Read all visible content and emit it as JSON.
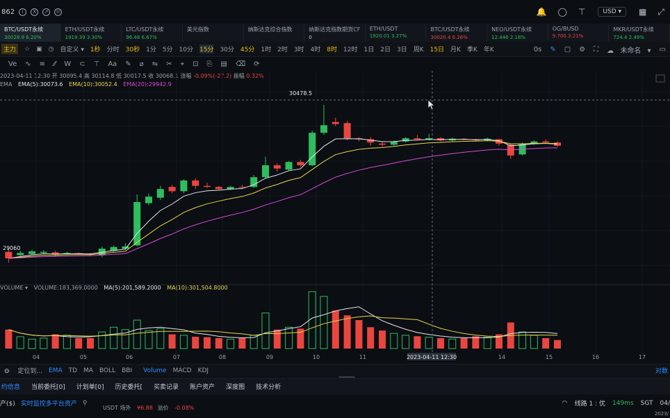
{
  "header": {
    "price_id": "862",
    "right_select": "USD",
    "icons": [
      "bell-icon",
      "search-icon",
      "shirt-icon",
      "grid-icon",
      "expand-icon"
    ]
  },
  "tickers": [
    {
      "name": "BTC/USDT永续",
      "value": "30028.9  6.20%",
      "dir": "up",
      "active": true
    },
    {
      "name": "ETH/USDT永续",
      "value": "1919.39  3.30%",
      "dir": "up"
    },
    {
      "name": "LTC/USDT永续",
      "value": "96.48  6.67%",
      "dir": "up"
    },
    {
      "name": "美元指数",
      "value": "",
      "dir": "none"
    },
    {
      "name": "纳斯达克综合指数",
      "value": "",
      "dir": "none"
    },
    {
      "name": "纳斯达克指数期货CF",
      "value": "0",
      "dir": "none"
    },
    {
      "name": "ETH/USDT",
      "value": "1920.01  3.27%",
      "dir": "up"
    },
    {
      "name": "BTC/USDT永续",
      "value": "30020.4  6.26%",
      "dir": "down"
    },
    {
      "name": "NEO/USDT永续",
      "value": "12.446  2.18%",
      "dir": "up"
    },
    {
      "name": "OG/BUSD",
      "value": "9.700  3.21%",
      "dir": "down"
    },
    {
      "name": "MKR/USDT永续",
      "value": "724.4  2.49%",
      "dir": "up"
    }
  ],
  "intervals": {
    "lead": "主力",
    "custom": "自定义",
    "items": [
      "1秒",
      "分时",
      "30秒",
      "1分",
      "5分",
      "10分",
      "15分",
      "30分",
      "45分",
      "1时",
      "2时",
      "3时",
      "4时",
      "8时",
      "12时",
      "1日",
      "2日",
      "3日",
      "周K",
      "15日",
      "月K",
      "季K",
      "年K"
    ],
    "active": "15分",
    "right_label": "0s",
    "layout_name": "未命名"
  },
  "tools": [
    "Ve",
    "∿",
    "≡",
    "⁄⁄",
    "W",
    "⊂",
    "⊤",
    "Aa",
    "✎",
    "⌀",
    "⇋",
    "✂",
    "⌖",
    "⊡",
    "⎘",
    "▤",
    "⌫",
    "⟳"
  ],
  "ohlc": {
    "date": "2023-04-11 12:30",
    "open_label": "开",
    "open": "30095.4",
    "high_label": "高",
    "high": "30114.8",
    "low_label": "低",
    "low": "30017.5",
    "close_label": "收",
    "close": "30068.1",
    "change_label": "涨幅",
    "change": "-0.09%(-27.2)",
    "amp_label": "振幅",
    "amp": "0.32%"
  },
  "ema_legend": {
    "label": "EMA",
    "ema5": "EMA(5):30073.6",
    "ema10": "EMA(10):30052.4",
    "ema20": "EMA(20):29942.9",
    "colors": {
      "ema5": "#e4e7ec",
      "ema10": "#e8d84b",
      "ema20": "#d84bd8"
    }
  },
  "vol_legend": {
    "label": "VOLUME",
    "vol": "VOLUME:183,369.0000",
    "ma5": "MA(5):201,589.2000",
    "ma10": "MA(10):301,504.8000"
  },
  "chart_data": {
    "type": "candlestick",
    "x_ticks": [
      "04",
      "05",
      "06",
      "07",
      "08",
      "09",
      "10",
      "11",
      "14",
      "15",
      "16",
      "17"
    ],
    "crosshair_label": "2023-04-11 12:30",
    "high_marker": "30478.5",
    "low_marker": "29060",
    "candles": [
      {
        "o": 29120,
        "c": 29060,
        "h": 29160,
        "l": 29020
      },
      {
        "o": 29090,
        "c": 29110,
        "h": 29130,
        "l": 29080
      },
      {
        "o": 29100,
        "c": 29125,
        "h": 29140,
        "l": 29090
      },
      {
        "o": 29110,
        "c": 29120,
        "h": 29135,
        "l": 29100
      },
      {
        "o": 29115,
        "c": 29095,
        "h": 29130,
        "l": 29080
      },
      {
        "o": 29100,
        "c": 29110,
        "h": 29120,
        "l": 29090
      },
      {
        "o": 29108,
        "c": 29102,
        "h": 29115,
        "l": 29095
      },
      {
        "o": 29100,
        "c": 29095,
        "h": 29110,
        "l": 29085
      },
      {
        "o": 29090,
        "c": 29150,
        "h": 29170,
        "l": 29070
      },
      {
        "o": 29130,
        "c": 29165,
        "h": 29180,
        "l": 29120
      },
      {
        "o": 29150,
        "c": 29170,
        "h": 29200,
        "l": 29140
      },
      {
        "o": 29180,
        "c": 29580,
        "h": 29650,
        "l": 29170
      },
      {
        "o": 29570,
        "c": 29630,
        "h": 29660,
        "l": 29550
      },
      {
        "o": 29620,
        "c": 29700,
        "h": 29730,
        "l": 29600
      },
      {
        "o": 29720,
        "c": 29680,
        "h": 29740,
        "l": 29660
      },
      {
        "o": 29680,
        "c": 29780,
        "h": 29790,
        "l": 29660
      },
      {
        "o": 29780,
        "c": 29730,
        "h": 29800,
        "l": 29700
      },
      {
        "o": 29730,
        "c": 29720,
        "h": 29760,
        "l": 29710
      },
      {
        "o": 29720,
        "c": 29700,
        "h": 29730,
        "l": 29690
      },
      {
        "o": 29700,
        "c": 29720,
        "h": 29730,
        "l": 29690
      },
      {
        "o": 29720,
        "c": 29715,
        "h": 29740,
        "l": 29700
      },
      {
        "o": 29720,
        "c": 29810,
        "h": 29830,
        "l": 29710
      },
      {
        "o": 29810,
        "c": 29920,
        "h": 30000,
        "l": 29800
      },
      {
        "o": 29920,
        "c": 29890,
        "h": 29940,
        "l": 29860
      },
      {
        "o": 29880,
        "c": 29950,
        "h": 29960,
        "l": 29870
      },
      {
        "o": 29950,
        "c": 29920,
        "h": 29970,
        "l": 29900
      },
      {
        "o": 29920,
        "c": 30220,
        "h": 30240,
        "l": 29910
      },
      {
        "o": 30220,
        "c": 30290,
        "h": 30478,
        "l": 30200
      },
      {
        "o": 30320,
        "c": 30300,
        "h": 30360,
        "l": 30280
      },
      {
        "o": 30310,
        "c": 30170,
        "h": 30330,
        "l": 30150
      },
      {
        "o": 30170,
        "c": 30160,
        "h": 30180,
        "l": 30140
      },
      {
        "o": 30160,
        "c": 30130,
        "h": 30180,
        "l": 30100
      },
      {
        "o": 30120,
        "c": 30110,
        "h": 30140,
        "l": 30090
      },
      {
        "o": 30110,
        "c": 30140,
        "h": 30150,
        "l": 30100
      },
      {
        "o": 30140,
        "c": 30170,
        "h": 30180,
        "l": 30130
      },
      {
        "o": 30170,
        "c": 30160,
        "h": 30200,
        "l": 30150
      },
      {
        "o": 30160,
        "c": 30170,
        "h": 30210,
        "l": 30150
      },
      {
        "o": 30170,
        "c": 30150,
        "h": 30180,
        "l": 30140
      },
      {
        "o": 30150,
        "c": 30165,
        "h": 30175,
        "l": 30140
      },
      {
        "o": 30165,
        "c": 30160,
        "h": 30170,
        "l": 30150
      },
      {
        "o": 30160,
        "c": 30150,
        "h": 30165,
        "l": 30140
      },
      {
        "o": 30150,
        "c": 30165,
        "h": 30175,
        "l": 30140
      },
      {
        "o": 30160,
        "c": 30120,
        "h": 30165,
        "l": 30100
      },
      {
        "o": 30110,
        "c": 30010,
        "h": 30120,
        "l": 29980
      },
      {
        "o": 30020,
        "c": 30120,
        "h": 30130,
        "l": 30010
      },
      {
        "o": 30120,
        "c": 30140,
        "h": 30150,
        "l": 30110
      },
      {
        "o": 30140,
        "c": 30130,
        "h": 30160,
        "l": 30120
      },
      {
        "o": 30130,
        "c": 30100,
        "h": 30140,
        "l": 30090
      }
    ],
    "volumes": [
      40,
      25,
      20,
      22,
      30,
      28,
      22,
      22,
      35,
      45,
      40,
      60,
      38,
      42,
      30,
      28,
      25,
      24,
      22,
      20,
      22,
      28,
      75,
      40,
      45,
      42,
      120,
      110,
      80,
      70,
      60,
      45,
      38,
      32,
      28,
      26,
      24,
      22,
      20,
      22,
      26,
      24,
      30,
      55,
      35,
      28,
      22,
      18
    ],
    "vol_colors": [
      "down",
      "up",
      "up",
      "up",
      "down",
      "up",
      "down",
      "down",
      "up",
      "up",
      "up",
      "up",
      "up",
      "up",
      "down",
      "up",
      "down",
      "down",
      "down",
      "up",
      "down",
      "up",
      "up",
      "down",
      "up",
      "down",
      "up",
      "up",
      "down",
      "down",
      "down",
      "down",
      "down",
      "up",
      "up",
      "down",
      "up",
      "down",
      "up",
      "down",
      "down",
      "up",
      "down",
      "down",
      "up",
      "up",
      "down",
      "down"
    ],
    "y_range": [
      28900,
      30600
    ]
  },
  "indicator_bar": {
    "fixed_label": "定位到...",
    "items": [
      "EMA",
      "TD",
      "MA",
      "BOLL",
      "BBI",
      "Volume",
      "MACD",
      "KDJ"
    ],
    "active": [
      "EMA",
      "Volume"
    ],
    "right": "对数"
  },
  "bottom_tabs": [
    "约信息",
    "当前委托[0]",
    "计划单[0]",
    "历史委托[",
    "买卖记录",
    "账户资产",
    "深度图",
    "技术分析"
  ],
  "footer": {
    "asset": "产($)",
    "monitor": "实时监控多平台资产",
    "usdt_label": "USDT 场外",
    "usdt_val": "¥6.88",
    "usdt_prem_label": "溢价",
    "usdt_prem": "-0.08%",
    "line_label": "线路 1 : 优",
    "latency": "149ms",
    "tz": "SGT",
    "date_short": "04/",
    "year_short": "2023/"
  }
}
